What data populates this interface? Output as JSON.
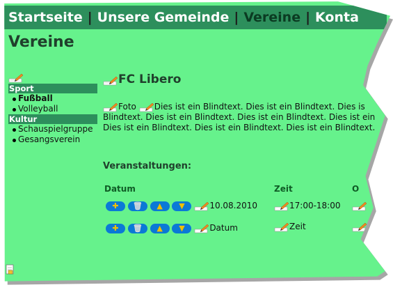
{
  "nav": {
    "items": [
      "Startseite",
      "Unsere Gemeinde",
      "Vereine",
      "Konta"
    ],
    "separator": "|",
    "active_index": 2
  },
  "page_title": "Vereine",
  "sidebar": {
    "categories": [
      {
        "label": "Sport",
        "items": [
          {
            "label": "Fußball",
            "bold": true
          },
          {
            "label": "Volleyball",
            "bold": false
          }
        ]
      },
      {
        "label": "Kultur",
        "items": [
          {
            "label": "Schauspielgruppe",
            "bold": false
          },
          {
            "label": "Gesangsverein",
            "bold": false
          }
        ]
      }
    ]
  },
  "club": {
    "title": "FC Libero",
    "photo_label": "Foto",
    "text_line1": "Dies ist ein Blindtext. Dies ist ein Blindtext. Dies is",
    "text_line2": "Blindtext. Dies ist ein Blindtext. Dies ist ein Blindtext. Dies ist ein",
    "text_line3": "Dies ist ein Blindtext. Dies ist ein Blindtext. Dies ist ein Blindtext."
  },
  "events": {
    "heading": "Veranstaltungen:",
    "columns": [
      "Datum",
      "Zeit",
      "O"
    ],
    "rows": [
      {
        "date": "10.08.2010",
        "time": "17:00-18:00"
      },
      {
        "date": "Datum",
        "time": "Zeit"
      }
    ]
  },
  "colors": {
    "background": "#66f28c",
    "navbar": "#2d8f5c",
    "button": "#0b79d6"
  }
}
